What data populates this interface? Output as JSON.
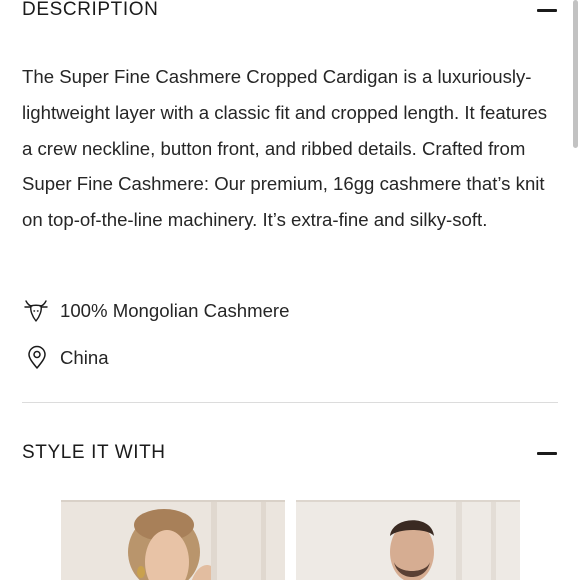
{
  "description_section": {
    "title": "DESCRIPTION",
    "body": "The Super Fine Cashmere Cropped Cardigan is a luxuriously-lightweight layer with a classic fit and cropped length. It features a crew neckline, button front, and ribbed details. Crafted from Super Fine Cashmere: Our premium, 16gg cashmere that’s knit on top-of-the-line machinery. It’s extra-fine and silky-soft.",
    "collapse_icon": "minus-icon",
    "attributes": [
      {
        "icon": "goat-icon",
        "text": "100% Mongolian Cashmere"
      },
      {
        "icon": "location-pin-icon",
        "text": "China"
      }
    ]
  },
  "style_section": {
    "title": "STYLE IT WITH",
    "collapse_icon": "minus-icon",
    "products": [
      {
        "image": "woman-model-photo"
      },
      {
        "image": "man-model-photo"
      }
    ]
  }
}
